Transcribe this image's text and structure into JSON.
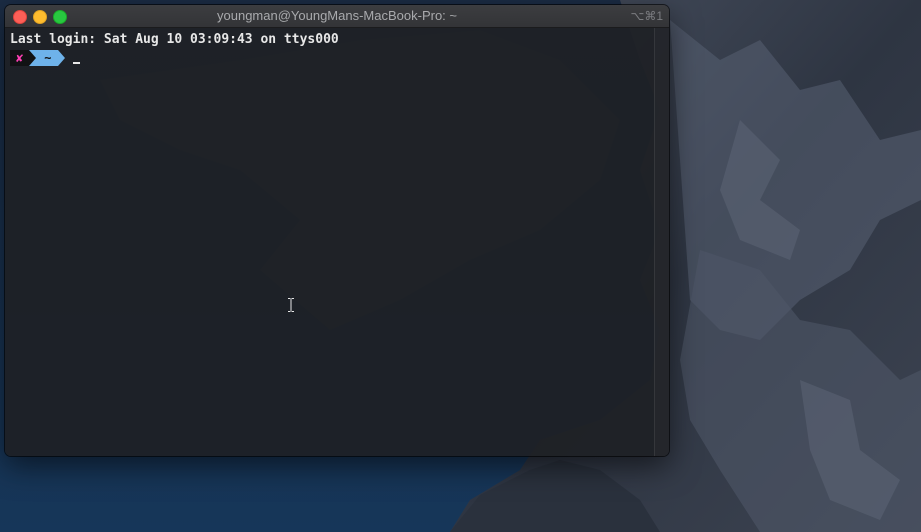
{
  "window": {
    "title": "youngman@YoungMans-MacBook-Pro: ~",
    "shortcut": "⌥⌘1"
  },
  "terminal": {
    "last_login": "Last login: Sat Aug 10 03:09:43 on ttys000",
    "prompt_status_symbol": "✘",
    "prompt_directory": "~",
    "cursor_glyph": "_"
  },
  "colors": {
    "close": "#fd5f57",
    "minimize": "#febc2e",
    "zoom": "#28c840",
    "status_symbol": "#ff3fb4",
    "directory_segment": "#6eb2ea"
  },
  "icons": {
    "mouse_pointer": "i-beam-cursor-icon"
  }
}
